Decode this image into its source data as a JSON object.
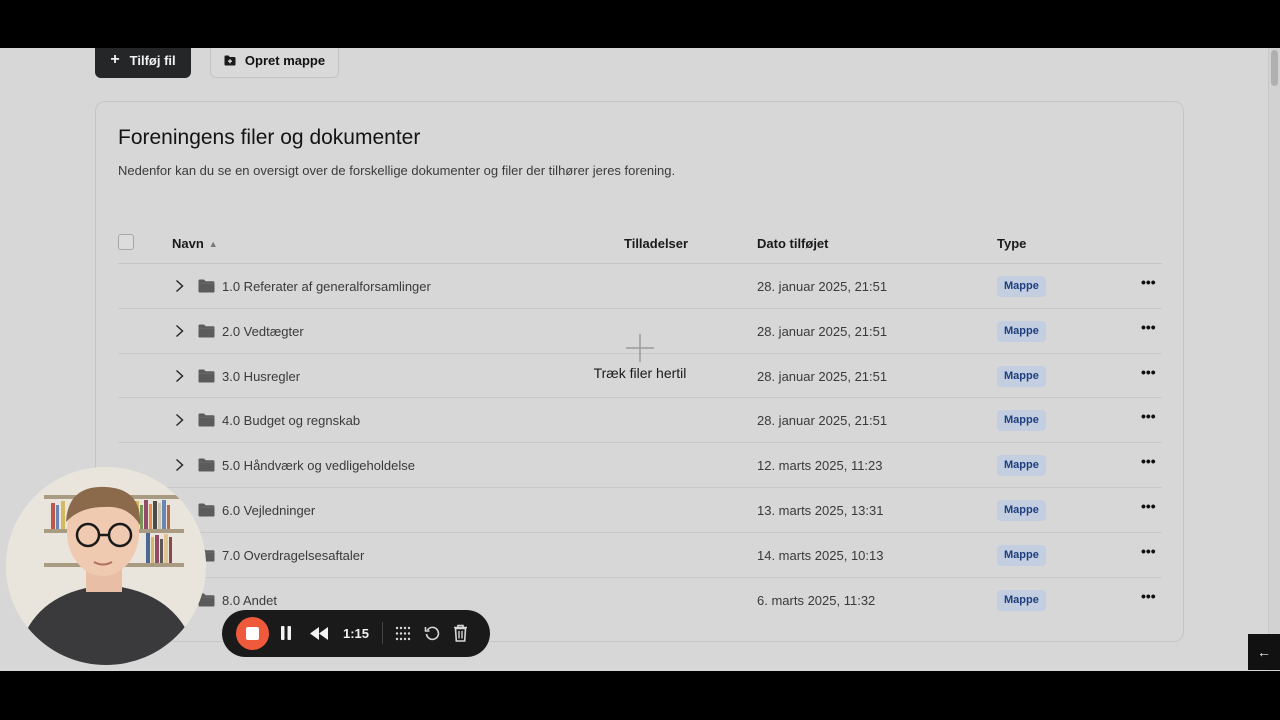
{
  "toolbar": {
    "add_file_label": "Tilføj fil",
    "create_folder_label": "Opret mappe"
  },
  "card": {
    "title": "Foreningens filer og dokumenter",
    "description": "Nedenfor kan du se en oversigt over de forskellige dokumenter og filer der tilhører jeres forening."
  },
  "table": {
    "columns": {
      "name": "Navn",
      "permissions": "Tilladelser",
      "date_added": "Dato tilføjet",
      "type": "Type"
    },
    "sort_column": "name",
    "sort_direction": "ascending",
    "rows": [
      {
        "name": "1.0 Referater af generalforsamlinger",
        "date": "28. januar 2025, 21:51",
        "type": "Mappe"
      },
      {
        "name": "2.0 Vedtægter",
        "date": "28. januar 2025, 21:51",
        "type": "Mappe"
      },
      {
        "name": "3.0 Husregler",
        "date": "28. januar 2025, 21:51",
        "type": "Mappe"
      },
      {
        "name": "4.0 Budget og regnskab",
        "date": "28. januar 2025, 21:51",
        "type": "Mappe"
      },
      {
        "name": "5.0 Håndværk og vedligeholdelse",
        "date": "12. marts 2025, 11:23",
        "type": "Mappe"
      },
      {
        "name": "6.0 Vejledninger",
        "date": "13. marts 2025, 13:31",
        "type": "Mappe"
      },
      {
        "name": "7.0 Overdragelsesaftaler",
        "date": "14. marts 2025, 10:13",
        "type": "Mappe"
      },
      {
        "name": "8.0 Andet",
        "date": "6. marts 2025, 11:32",
        "type": "Mappe"
      }
    ]
  },
  "drop_zone": {
    "label": "Træk filer hertil",
    "icon": "plus-icon"
  },
  "recorder": {
    "elapsed": "1:15",
    "icons": [
      "stop-icon",
      "pause-icon",
      "rewind-icon",
      "grid-icon",
      "reset-icon",
      "trash-icon"
    ]
  },
  "back_button": {
    "icon": "arrow-left-icon",
    "glyph": "←"
  },
  "colors": {
    "page_background": "#d7d7d7",
    "primary_button": "#242628",
    "badge_background": "#c3cfe0",
    "badge_text": "#1e3e7e",
    "record_stop": "#f05a3c"
  }
}
